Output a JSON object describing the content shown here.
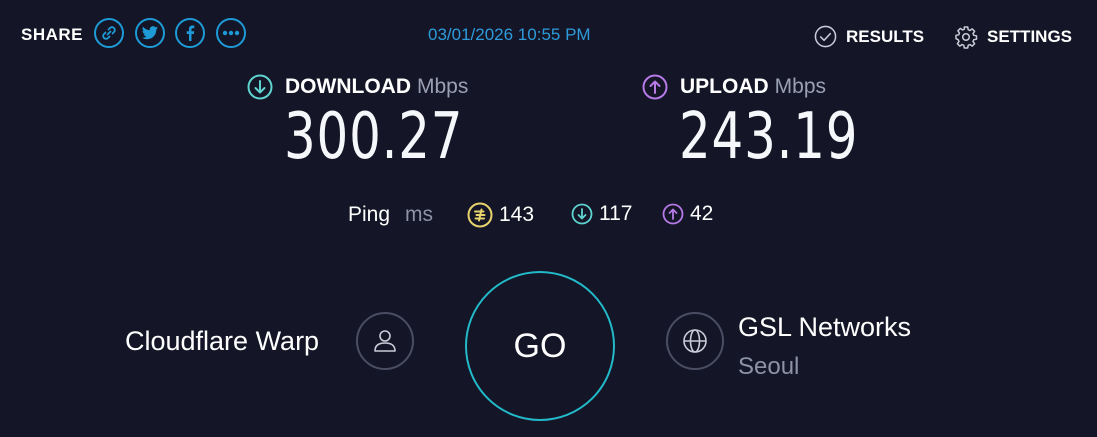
{
  "header": {
    "share_label": "SHARE",
    "share_icons": [
      "link-icon",
      "twitter-icon",
      "facebook-icon",
      "more-icon"
    ],
    "timestamp": "03/01/2026 10:55 PM",
    "results_label": "RESULTS",
    "settings_label": "SETTINGS"
  },
  "download": {
    "label": "DOWNLOAD",
    "unit": "Mbps",
    "value": "300.27",
    "icon": "download-arrow-icon"
  },
  "upload": {
    "label": "UPLOAD",
    "unit": "Mbps",
    "value": "243.19",
    "icon": "upload-arrow-icon"
  },
  "ping": {
    "label": "Ping",
    "unit": "ms",
    "idle": "143",
    "download": "117",
    "upload": "42"
  },
  "go_label": "GO",
  "provider": {
    "name": "Cloudflare Warp",
    "icon": "user-icon"
  },
  "server": {
    "name": "GSL Networks",
    "location": "Seoul",
    "icon": "globe-icon"
  },
  "colors": {
    "background": "#141526",
    "accent_blue": "#1e9bd7",
    "download": "#5ed3cf",
    "upload": "#b57ae6",
    "ping_idle": "#e8d46d",
    "go_ring": "#22b9c9"
  }
}
